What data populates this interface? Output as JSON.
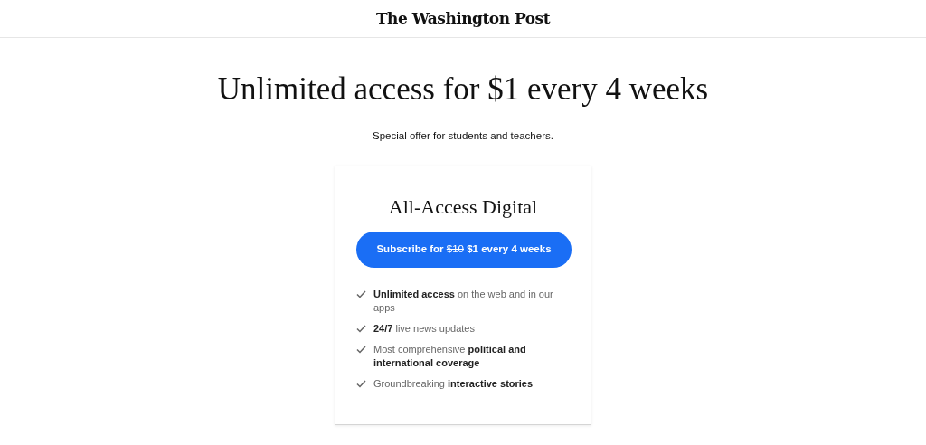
{
  "header": {
    "logo": "The Washington Post"
  },
  "headline": "Unlimited access for $1 every 4 weeks",
  "subtitle": "Special offer for students and teachers.",
  "plan": {
    "title": "All-Access Digital",
    "button": {
      "prefix": "Subscribe for",
      "old_price": "$10",
      "new_price": "$1 every 4 weeks"
    },
    "features": [
      "**Unlimited access** on the web and in our apps",
      "**24/7** live news updates",
      "Most comprehensive **political and international coverage**",
      "Groundbreaking **interactive stories**"
    ]
  }
}
